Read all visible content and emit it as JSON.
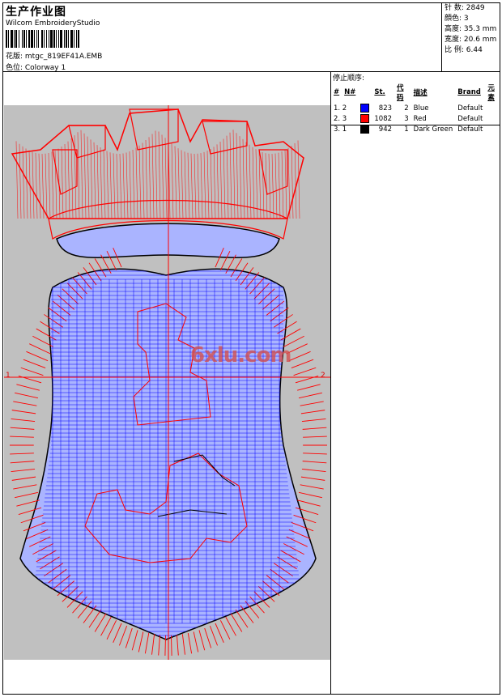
{
  "header": {
    "title": "生产作业图",
    "software": "Wilcom EmbroideryStudio",
    "design_label": "花版: mtgc_819EF41A.EMB",
    "colorway_label": "色位: Colorway 1"
  },
  "info": {
    "stitches": "针 数: 2849",
    "colors": "顔色: 3",
    "height": "高度: 35.3 mm",
    "width": "宽度: 20.6 mm",
    "scale": "比 例: 6.44"
  },
  "stop_sequence": {
    "title": "停止顺序:",
    "columns": [
      "#",
      "N#",
      "St.",
      "代码",
      "描述",
      "Brand",
      "元素"
    ],
    "rows": [
      {
        "idx": "1. 2",
        "color": "#0000ff",
        "stitches": "823",
        "code": "2",
        "desc": "Blue",
        "brand": "Default"
      },
      {
        "idx": "2. 3",
        "color": "#ff0000",
        "stitches": "1082",
        "code": "3",
        "desc": "Red",
        "brand": "Default"
      },
      {
        "idx": "3. 1",
        "color": "#000000",
        "stitches": "942",
        "code": "1",
        "desc": "Dark Green",
        "brand": "Default"
      }
    ]
  },
  "design": {
    "axis_left": "1",
    "axis_right": "2",
    "watermark": "6xlu.com",
    "background": "#c0c0c0",
    "fill_color": "#aab4ff",
    "stitch_red": "#ff0000",
    "stitch_blue": "#0000ff"
  }
}
